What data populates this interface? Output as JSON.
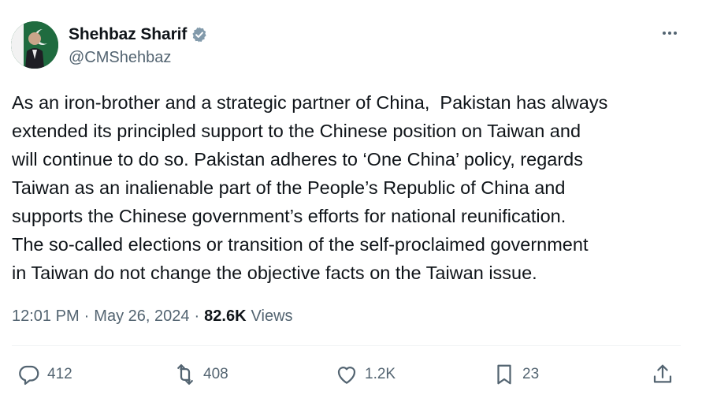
{
  "author": {
    "display_name": "Shehbaz Sharif",
    "handle": "@CMShehbaz",
    "verified": true
  },
  "tweet": {
    "text": "As an iron-brother and a strategic partner of China,  Pakistan has always\nextended its principled support to the Chinese position on Taiwan and\nwill continue to do so. Pakistan adheres to ‘One China’ policy, regards\nTaiwan as an inalienable part of the People’s Republic of China and\nsupports the Chinese government’s efforts for national reunification.\nThe so-called elections or transition of the self-proclaimed government\nin Taiwan do not change the objective facts on the Taiwan issue."
  },
  "meta": {
    "time": "12:01 PM",
    "separator": "·",
    "date": "May 26, 2024",
    "views_count": "82.6K",
    "views_label": "Views"
  },
  "actions": {
    "replies": "412",
    "reposts": "408",
    "likes": "1.2K",
    "bookmarks": "23"
  },
  "icons": {
    "more": "more-horizontal-icon",
    "reply": "reply-icon",
    "repost": "repost-icon",
    "like": "heart-icon",
    "bookmark": "bookmark-icon",
    "share": "share-icon",
    "verified": "verified-badge-icon"
  },
  "colors": {
    "text": "#0f1419",
    "secondary": "#536471",
    "divider": "#eff3f4",
    "verified_badge": "#829aab"
  }
}
